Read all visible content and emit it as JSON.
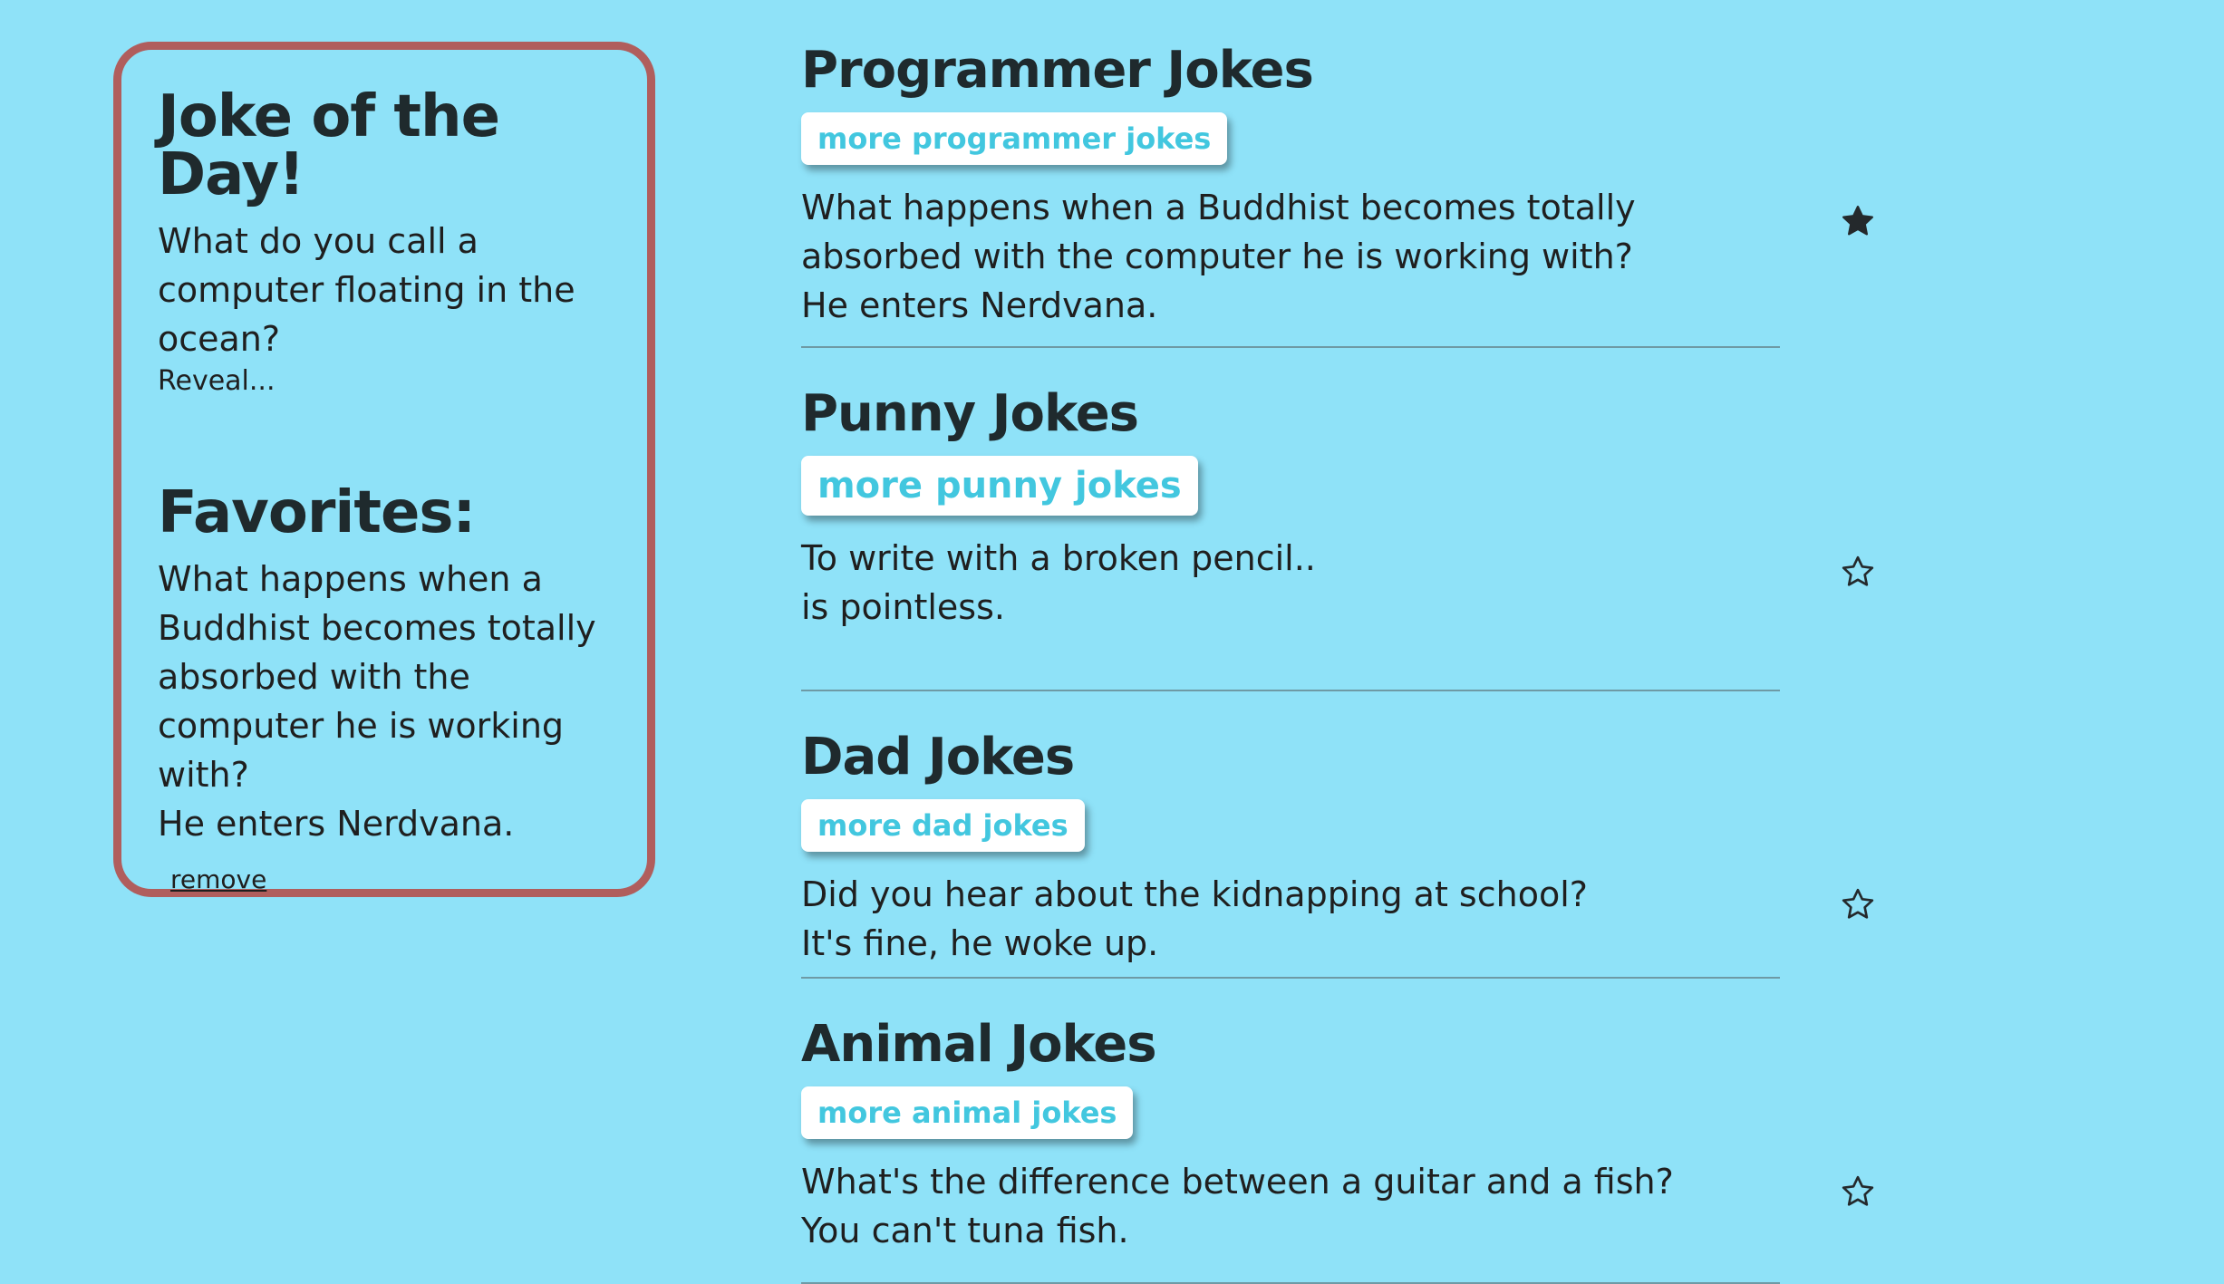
{
  "sidebar": {
    "joke_of_day_title": "Joke of the Day!",
    "joke_of_day_text": "What do you call a computer floating in the ocean?",
    "reveal_label": "Reveal...",
    "favorites_title": "Favorites:",
    "favorite_question": "What happens when a Buddhist becomes totally absorbed with the computer he is working with?",
    "favorite_answer": "He enters Nerdvana.",
    "remove_label": "remove"
  },
  "sections": [
    {
      "title": "Programmer Jokes",
      "button_label": "more programmer jokes",
      "question": "What happens when a Buddhist becomes totally absorbed with the computer he is working with?",
      "answer": "He enters Nerdvana.",
      "favorited": true,
      "star_icon": "star-filled-icon"
    },
    {
      "title": "Punny Jokes",
      "button_label": "more punny jokes",
      "question": "To write with a broken pencil..",
      "answer": "is pointless.",
      "favorited": false,
      "star_icon": "star-outline-icon"
    },
    {
      "title": "Dad Jokes",
      "button_label": "more dad jokes",
      "question": "Did you hear about the kidnapping at school?",
      "answer": "It's fine, he woke up.",
      "favorited": false,
      "star_icon": "star-outline-icon"
    },
    {
      "title": "Animal Jokes",
      "button_label": "more animal jokes",
      "question": "What's the difference between a guitar and a fish?",
      "answer": "You can't tuna fish.",
      "favorited": false,
      "star_icon": "star-outline-icon"
    }
  ],
  "colors": {
    "background": "#8fe2f8",
    "card_border": "#b05e5d",
    "button_text": "#42c7df",
    "text": "#1f1f1f"
  }
}
